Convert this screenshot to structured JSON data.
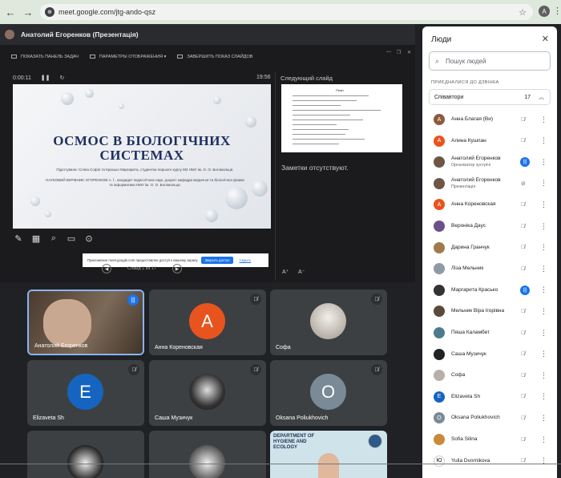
{
  "browser": {
    "url": "meet.google.com/jtg-ando-qsz",
    "profile_initial": "A"
  },
  "presenter_bar": {
    "name": "Анатолий Егоренков (Презентація)"
  },
  "slideshow": {
    "toolbar": {
      "show_taskbar": "ПОКАЗАТЬ ПАНЕЛЬ ЗАДАЧ",
      "display_settings": "ПАРАМЕТРЫ ОТОБРАЖЕНИЯ ▾",
      "end_show": "ЗАВЕРШИТЬ ПОКАЗ СЛАЙДОВ"
    },
    "elapsed": "0:00:11",
    "clock": "19:56",
    "next_slide_label": "Следующий слайд",
    "notes": "Заметки отсутствуют.",
    "slide": {
      "title_line1": "ОСМОС В БІОЛОГІЧНИХ",
      "title_line2": "СИСТЕМАХ",
      "subtitle1": "Підготували: Сіліна Софія та Красько Маргарита, студентки першого курсу М2 НМУ ім. О. О. Богомольця.",
      "subtitle2": "НАУКОВИЙ КЕРІВНИК: ЕГОРЕНКОВ А. Ї., кандидат педагогічних наук, доцент кафедри медичної та біологічної фізики та інформатики НМУ ім. О. О. Богомольця."
    },
    "next_slide_title": "План",
    "slide_counter": "Слайд 1 из 17",
    "share_notice": "Приложение meet.google.com предоставлен доступ к вашему экрану.",
    "share_ok": "Закрыть доступ",
    "share_hide": "Скрыть"
  },
  "tiles": [
    {
      "name": "Анатолий Егоренков",
      "initial": "",
      "color": "#5d4a3a",
      "muted": false
    },
    {
      "name": "Анна Кореновская",
      "initial": "A",
      "color": "#e8541d",
      "muted": true
    },
    {
      "name": "Софа",
      "initial": "",
      "color": "#b7b0a8",
      "muted": true
    },
    {
      "name": "Elizaveta Sh",
      "initial": "E",
      "color": "#1565c0",
      "muted": true
    },
    {
      "name": "Саша Музичук",
      "initial": "",
      "color": "#2b2b2b",
      "muted": true
    },
    {
      "name": "Oksana Poliukhovich",
      "initial": "O",
      "color": "#7a8a96",
      "muted": true
    },
    {
      "name": "",
      "initial": "",
      "color": "#2b2b2b",
      "muted": false
    },
    {
      "name": "",
      "initial": "",
      "color": "#2b2b2b",
      "muted": false
    },
    {
      "name": "",
      "initial": "",
      "color": "#2b2b2b",
      "muted": false
    }
  ],
  "dept_text": "DEPARTMENT OF HYGIENE AND ECOLOGY",
  "people_panel": {
    "title": "Люди",
    "search_placeholder": "Пошук людей",
    "section": "ПРИЄДНАЛИСЯ ДО ДЗВІНКА",
    "group_label": "Співавтори",
    "group_count": "17",
    "people": [
      {
        "name": "Анна Благая (Ви)",
        "role": "",
        "initial": "A",
        "color": "#8d5a3b",
        "mic": "muted"
      },
      {
        "name": "Алина Кушпан",
        "role": "",
        "initial": "A",
        "color": "#e8541d",
        "mic": "muted"
      },
      {
        "name": "Анатолий Егоренков",
        "role": "Організатор зустрічі",
        "initial": "",
        "color": "#6d5645",
        "mic": "live"
      },
      {
        "name": "Анатолий Егоренков",
        "role": "Презентація",
        "initial": "",
        "color": "#6d5645",
        "mic": "off"
      },
      {
        "name": "Анна Кореновская",
        "role": "",
        "initial": "A",
        "color": "#e8541d",
        "mic": "muted"
      },
      {
        "name": "Вероніка Даус",
        "role": "",
        "initial": "",
        "color": "#6b4f8a",
        "mic": "muted"
      },
      {
        "name": "Дарина Гранчук",
        "role": "",
        "initial": "",
        "color": "#a07a4a",
        "mic": "muted"
      },
      {
        "name": "Ліза Мельник",
        "role": "",
        "initial": "",
        "color": "#8e9aa5",
        "mic": "muted"
      },
      {
        "name": "Маргарита Красько",
        "role": "",
        "initial": "",
        "color": "#333333",
        "mic": "live"
      },
      {
        "name": "Мельник Віра Ігорівна",
        "role": "",
        "initial": "",
        "color": "#5a4a3a",
        "mic": "muted"
      },
      {
        "name": "Пяша Каламбет",
        "role": "",
        "initial": "",
        "color": "#4d7a8c",
        "mic": "muted"
      },
      {
        "name": "Саша Музичук",
        "role": "",
        "initial": "",
        "color": "#222222",
        "mic": "muted"
      },
      {
        "name": "Софа",
        "role": "",
        "initial": "",
        "color": "#b7b0a8",
        "mic": "muted"
      },
      {
        "name": "Elizaveta Sh",
        "role": "",
        "initial": "E",
        "color": "#1565c0",
        "mic": "muted"
      },
      {
        "name": "Oksana Poliukhovich",
        "role": "",
        "initial": "O",
        "color": "#7a8a96",
        "mic": "muted"
      },
      {
        "name": "Sofia Silina",
        "role": "",
        "initial": "",
        "color": "#c98a3a",
        "mic": "muted"
      },
      {
        "name": "Yulia Dvornikova",
        "role": "",
        "initial": "Ю",
        "color": "#ffffff",
        "mic": "muted"
      }
    ]
  }
}
